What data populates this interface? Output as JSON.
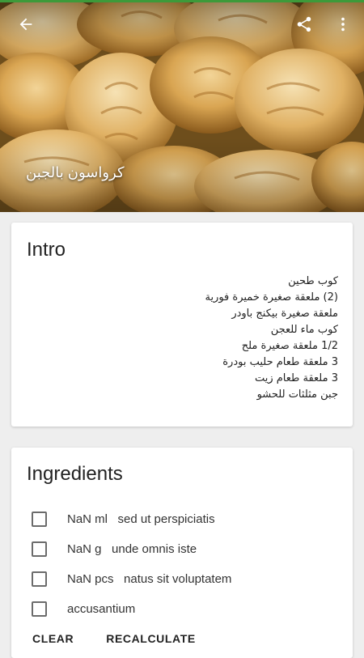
{
  "header": {
    "title": "كرواسون بالجبن",
    "back_icon": "arrow-back-icon",
    "share_icon": "share-icon",
    "more_icon": "more-vert-icon"
  },
  "intro": {
    "title": "Intro",
    "lines": [
      "كوب طحين",
      "(2) ملعقة صغيرة خميرة فورية",
      "ملعقة صغيرة بيكنج باودر",
      "كوب ماء للعجن",
      "1/2 ملعقة صغيرة ملح",
      "3 ملعقة طعام حليب بودرة",
      "3 ملعقة طعام زيت",
      "جبن مثلثات للحشو"
    ]
  },
  "ingredients": {
    "title": "Ingredients",
    "items": [
      {
        "text": "NaN ml   sed ut perspiciatis",
        "checked": false
      },
      {
        "text": "NaN g   unde omnis iste",
        "checked": false
      },
      {
        "text": "NaN pcs   natus sit voluptatem",
        "checked": false
      },
      {
        "text": "accusantium",
        "checked": false
      }
    ],
    "clear_label": "CLEAR",
    "recalculate_label": "RECALCULATE"
  },
  "colors": {
    "status_bar": "#3d9a3a",
    "background": "#eeeeee",
    "card": "#ffffff"
  }
}
